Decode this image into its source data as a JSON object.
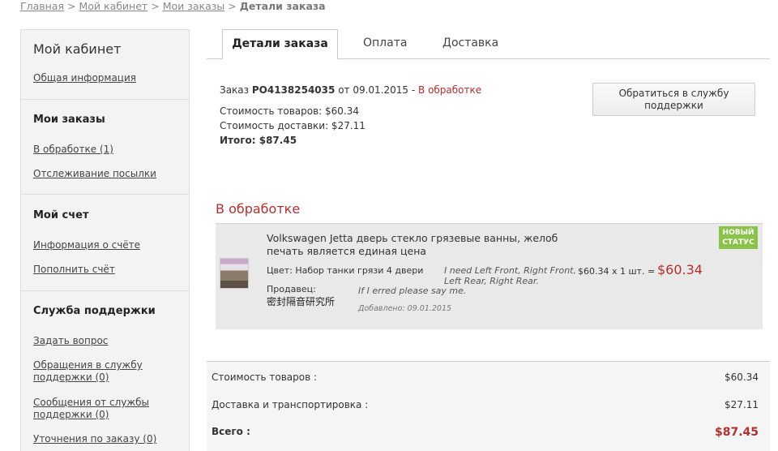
{
  "breadcrumb": {
    "home": "Главная",
    "cabinet": "Мой кабинет",
    "orders": "Мои заказы",
    "current": "Детали заказа",
    "sep": ">"
  },
  "sidebar": {
    "title": "Мой кабинет",
    "general": "Общая информация",
    "orders_head": "Мои заказы",
    "in_processing": "В обработке (1)",
    "tracking": "Отслеживание посылки",
    "account_head": "Мой счет",
    "account_info": "Информация о счёте",
    "top_up": "Пополнить счёт",
    "support_head": "Служба поддержки",
    "ask": "Задать вопрос",
    "to_support": "Обращения в службу поддержки (0)",
    "from_support": "Сообщения от службы поддержки (0)",
    "clarifications": "Уточнения по заказу (0)"
  },
  "tabs": [
    "Детали заказа",
    "Оплата",
    "Доставка"
  ],
  "order": {
    "prefix": "Заказ",
    "number": "PO4138254035",
    "date_prefix": "от 09.01.2015 -",
    "status": "В обработке",
    "goods_cost": "Стоимость товаров: $60.34",
    "delivery_cost": "Стоимость доставки: $27.11",
    "total": "Итого: $87.45",
    "support_button": "Обратиться в службу поддержки"
  },
  "section_title": "В обработке",
  "item": {
    "title": "Volkswagen Jetta дверь стекло грязевые ванны, желоб печать является единая цена",
    "attr": "Цвет: Набор танки грязи 4 двери",
    "note": "I need Left Front, Right Front, Left Rear, Right Rear.",
    "seller_label": "Продавец:",
    "seller": "密封隔音研究所",
    "note2": "If I erred please say me.",
    "added": "Добавлено:  09.01.2015",
    "price": "$60.34 x 1 шт. =",
    "total": "$60.34",
    "badge_line1": "НОВЫЙ",
    "badge_line2": "СТАТУС"
  },
  "summary": {
    "goods_label": "Стоимость товаров :",
    "goods_value": "$60.34",
    "delivery_label": "Доставка и транспортировка :",
    "delivery_value": "$27.11",
    "total_label": "Всего :",
    "total_value": "$87.45"
  },
  "colors": {
    "accent": "#b03030",
    "badge": "#8bc34a"
  }
}
